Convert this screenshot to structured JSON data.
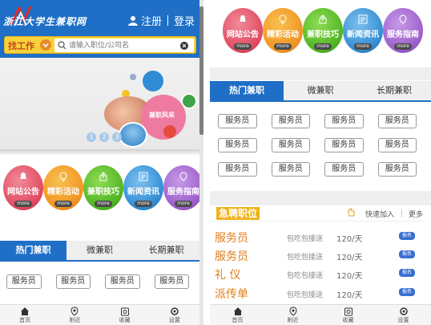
{
  "left": {
    "header": {
      "logo_text": "浙江大学生兼职网",
      "register": "注册",
      "login": "登录"
    },
    "search": {
      "category": "找工作",
      "placeholder": "请输入职位/公司名"
    },
    "banner": {
      "badge": "兼职风采",
      "dots": [
        "1",
        "2",
        "3"
      ]
    }
  },
  "categories": [
    {
      "label": "网站公告",
      "more": "more",
      "icon": "bell-icon"
    },
    {
      "label": "精彩活动",
      "more": "more",
      "icon": "cloud-icon"
    },
    {
      "label": "兼职技巧",
      "more": "more",
      "icon": "share-icon"
    },
    {
      "label": "新闻资讯",
      "more": "more",
      "icon": "news-icon"
    },
    {
      "label": "服务指南",
      "more": "more",
      "icon": "guide-icon"
    }
  ],
  "tabs": [
    "热门兼职",
    "微兼职",
    "长期兼职"
  ],
  "jobs": [
    "服务员",
    "服务员",
    "服务员",
    "服务员",
    "服务员",
    "服务员",
    "服务员",
    "服务员",
    "服务员",
    "服务员",
    "服务员",
    "服务员"
  ],
  "urgent": {
    "title": "急聘职位",
    "quick_join": "快速加入",
    "more": "更多",
    "rows": [
      {
        "name": "服务员",
        "tag": "包吃包接送",
        "pay": "120/天",
        "badge": "报名"
      },
      {
        "name": "服务员",
        "tag": "包吃包接送",
        "pay": "120/天",
        "badge": "报名"
      },
      {
        "name": "礼 仪",
        "tag": "包吃包接送",
        "pay": "120/天",
        "badge": "报名"
      },
      {
        "name": "派传单",
        "tag": "包吃包接送",
        "pay": "120/天",
        "badge": "报名"
      }
    ]
  },
  "footer": [
    {
      "label": "首页",
      "icon": "home-icon"
    },
    {
      "label": "附近",
      "icon": "location-icon"
    },
    {
      "label": "收藏",
      "icon": "favorite-icon"
    },
    {
      "label": "设置",
      "icon": "settings-icon"
    }
  ],
  "colors": {
    "brand_blue": "#1f6fc7",
    "search_yellow": "#f9d23a",
    "urgent_orange": "#e07d1a",
    "badge_blue": "#3a6fd0"
  }
}
